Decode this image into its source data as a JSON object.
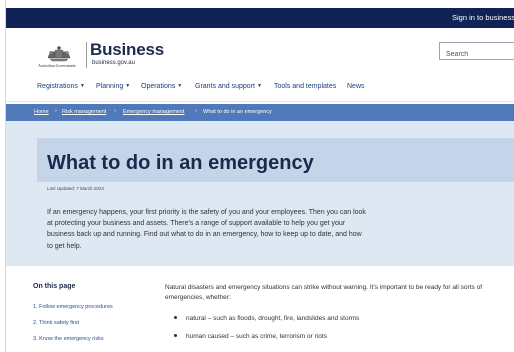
{
  "topbar": {
    "signin_label": "Sign in to business.gov.au"
  },
  "header": {
    "gov_label": "Australian Government",
    "site_title": "Business",
    "site_url": "business.gov.au",
    "search_placeholder": "Search"
  },
  "nav": {
    "items": [
      {
        "label": "Registrations",
        "has_menu": true
      },
      {
        "label": "Planning",
        "has_menu": true
      },
      {
        "label": "Operations",
        "has_menu": true
      },
      {
        "label": "Grants and support",
        "has_menu": true
      },
      {
        "label": "Tools and templates",
        "has_menu": false
      },
      {
        "label": "News",
        "has_menu": false
      }
    ]
  },
  "breadcrumb": {
    "items": [
      "Home",
      "Risk management",
      "Emergency management",
      "What to do in an emergency"
    ],
    "separator": "›"
  },
  "hero": {
    "title": "What to do in an emergency",
    "updated": "Last Updated: 7 March 2023",
    "intro": "If an emergency happens, your first priority is the safety of you and your employees. Then you can look at protecting your business and assets. There's a range of support available to help you get your business back up and running. Find out what to do in an emergency, how to keep up to date, and how to get help."
  },
  "toc": {
    "title": "On this page",
    "items": [
      "1. Follow emergency procedures",
      "2. Think safety first",
      "3. Know the emergency risks"
    ]
  },
  "content": {
    "paragraph": "Natural disasters and emergency situations can strike without warning. It's important to be ready for all sorts of emergencies, whether:",
    "bullets": [
      "natural – such as floods, drought, fire, landslides and storms",
      "human caused – such as crime, terrorism or riots"
    ]
  },
  "colors": {
    "topbar": "#0f2454",
    "breadcrumb_bar": "#4f79b9",
    "hero_bg": "#dde8f3",
    "hero_panel": "#c4d5ea",
    "link": "#1c3e7a"
  }
}
